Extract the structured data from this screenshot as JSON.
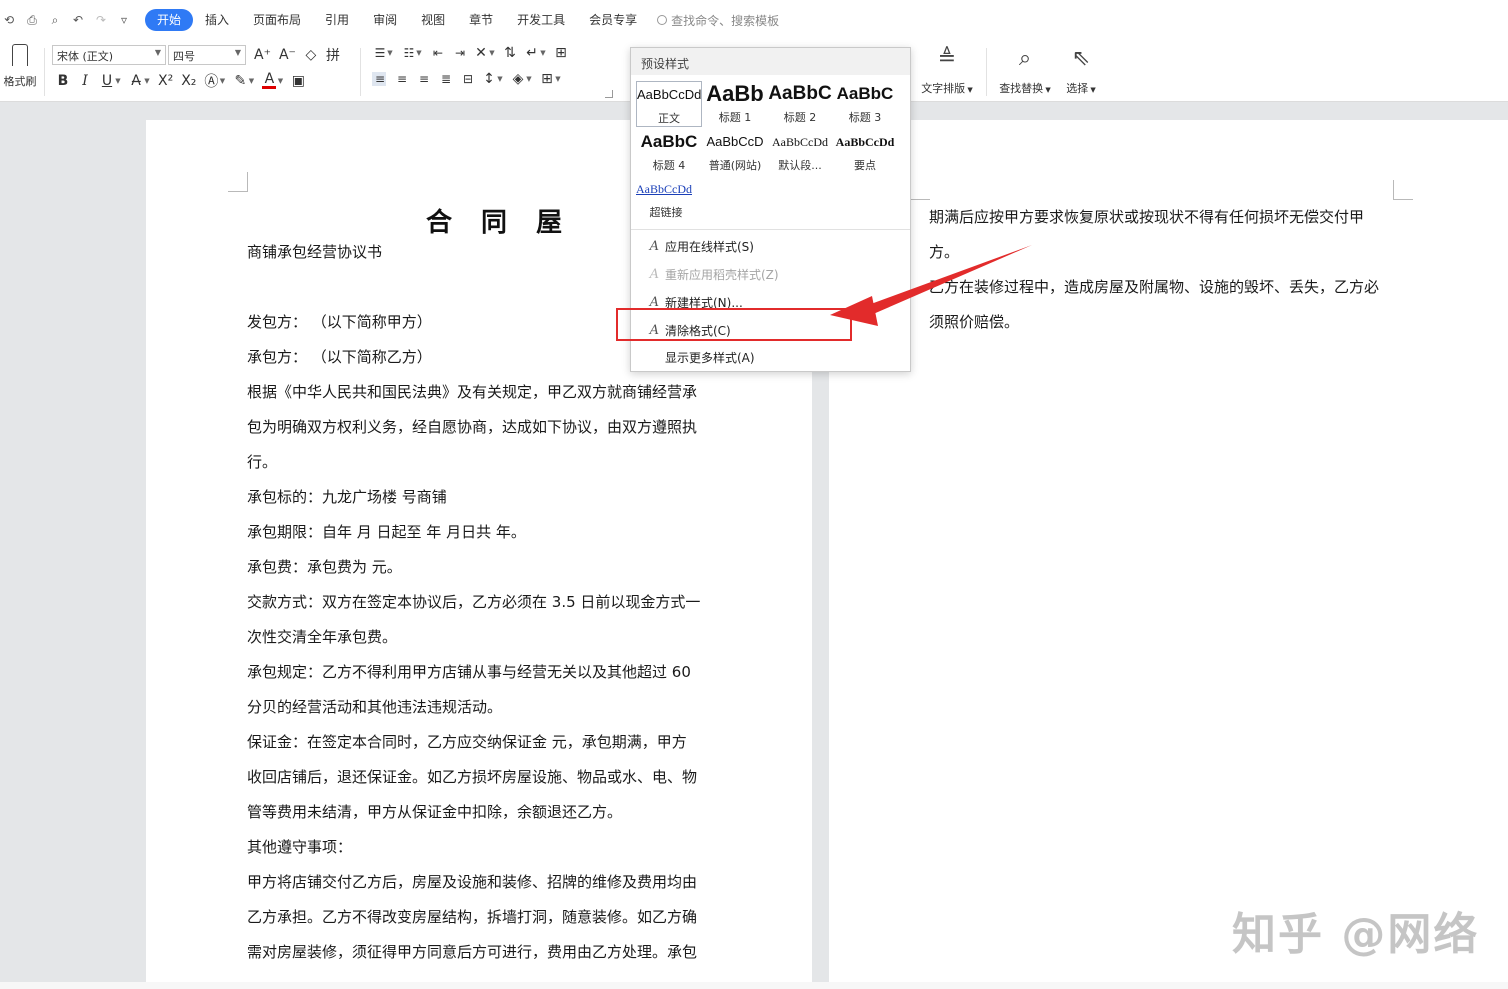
{
  "menu": {
    "tabs": [
      "开始",
      "插入",
      "页面布局",
      "引用",
      "审阅",
      "视图",
      "章节",
      "开发工具",
      "会员专享"
    ],
    "active_tab": "开始",
    "search_placeholder": "查找命令、搜索模板"
  },
  "toolbar": {
    "format_painter": "格式刷",
    "font_name": "宋体 (正文)",
    "font_size": "四号",
    "text_layout": "文字排版",
    "find_replace": "查找替换",
    "select": "选择"
  },
  "style_panel": {
    "header": "预设样式",
    "styles": [
      {
        "preview": "AaBbCcDd",
        "name": "正文"
      },
      {
        "preview": "AaBb",
        "name": "标题 1"
      },
      {
        "preview": "AaBbC",
        "name": "标题 2"
      },
      {
        "preview": "AaBbC",
        "name": "标题 3"
      },
      {
        "preview": "AaBbC",
        "name": "标题 4"
      },
      {
        "preview": "AaBbCcD",
        "name": "普通(网站)"
      },
      {
        "preview": "AaBbCcDd",
        "name": "默认段..."
      },
      {
        "preview": "AaBbCcDd",
        "name": "要点"
      },
      {
        "preview": "AaBbCcDd",
        "name": "超链接"
      }
    ],
    "commands": [
      {
        "label": "应用在线样式(S)",
        "enabled": true
      },
      {
        "label": "重新应用稻壳样式(Z)",
        "enabled": false
      },
      {
        "label": "新建样式(N)...",
        "enabled": true
      },
      {
        "label": "清除格式(C)",
        "enabled": true
      },
      {
        "label": "显示更多样式(A)",
        "enabled": true
      }
    ]
  },
  "document": {
    "title": "合 同 屋",
    "left_lines": [
      "商铺承包经营协议书",
      "",
      "发包方：              （以下简称甲方）",
      "承包方：              （以下简称乙方）",
      "根据《中华人民共和国民法典》及有关规定，甲乙双方就商铺经营承",
      "包为明确双方权利义务，经自愿协商，达成如下协议，由双方遵照执",
      "行。",
      "承包标的：九龙广场楼       号商铺",
      "承包期限：自年   月   日起至     年    月日共     年。",
      "承包费：承包费为 元。",
      "交款方式：双方在签定本协议后，乙方必须在 3.5 日前以现金方式一",
      "次性交清全年承包费。",
      "承包规定：乙方不得利用甲方店铺从事与经营无关以及其他超过 60",
      "分贝的经营活动和其他违法违规活动。",
      "保证金：在签定本合同时，乙方应交纳保证金 元，承包期满，甲方",
      "收回店铺后，退还保证金。如乙方损坏房屋设施、物品或水、电、物",
      "管等费用未结清，甲方从保证金中扣除，余额退还乙方。",
      "其他遵守事项：",
      "甲方将店铺交付乙方后，房屋及设施和装修、招牌的维修及费用均由",
      "乙方承担。乙方不得改变房屋结构，拆墙打洞，随意装修。如乙方确",
      "需对房屋装修，须征得甲方同意后方可进行，费用由乙方处理。承包"
    ],
    "right_lines": [
      "期满后应按甲方要求恢复原状或按现状不得有任何损坏无偿交付甲",
      "方。",
      "乙方在装修过程中，造成房屋及附属物、设施的毁坏、丢失，乙方必",
      "须照价赔偿。"
    ]
  },
  "watermark": "知乎 @网络",
  "colors": {
    "accent": "#2f7af5",
    "highlight": "#e22b2b",
    "arrow": "#e22b2b"
  }
}
